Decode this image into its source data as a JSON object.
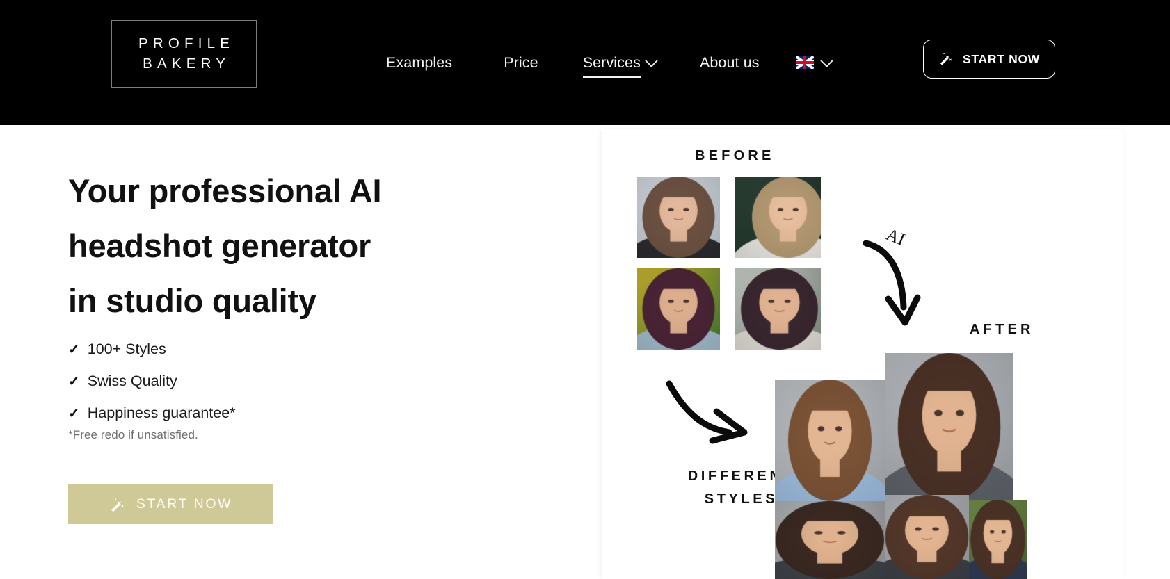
{
  "header": {
    "logo": {
      "line1": "PROFILE",
      "line2": "BAKERY",
      "name": "profile-bakery-logo"
    },
    "nav": [
      {
        "label": "Examples",
        "has_chevron": false,
        "underlined": false
      },
      {
        "label": "Price",
        "has_chevron": false,
        "underlined": false
      },
      {
        "label": "Services",
        "has_chevron": true,
        "underlined": true
      },
      {
        "label": "About us",
        "has_chevron": false,
        "underlined": false
      }
    ],
    "language": {
      "flag": "uk-flag-icon",
      "chevron": "chevron-down-icon"
    },
    "cta": {
      "label": "START NOW",
      "icon": "magic-wand-icon",
      "border_color": "#ffffff"
    }
  },
  "hero": {
    "headline_lines": [
      "Your professional AI",
      "headshot generator",
      "in studio quality"
    ],
    "benefits": [
      {
        "tick": "✓",
        "label": "100+ Styles"
      },
      {
        "tick": "✓",
        "label": "Swiss Quality"
      },
      {
        "tick": "✓",
        "label": "Happiness guarantee*"
      }
    ],
    "fineprint": "*Free redo if unsatisfied.",
    "cta": {
      "label": "START NOW",
      "icon": "magic-wand-icon",
      "background": "#cfc897",
      "text_color": "#ffffff"
    }
  },
  "showcase": {
    "label_before": "BEFORE",
    "label_after": "AFTER",
    "label_styles_line1": "DIFFERENT",
    "label_styles_line2": "STYLES",
    "ai_annotation": "AI",
    "arrows": [
      {
        "name": "ai-curved-arrow-icon",
        "direction": "down"
      },
      {
        "name": "styles-curved-arrow-icon",
        "direction": "down-right"
      }
    ],
    "before_photos": [
      {
        "name": "before-photo-1",
        "alt": "woman with long brown hair, grey studio background"
      },
      {
        "name": "before-photo-2",
        "alt": "woman with blonde hair, dark green background"
      },
      {
        "name": "before-photo-3",
        "alt": "woman with dark hair outdoors, yellow and green background"
      },
      {
        "name": "before-photo-4",
        "alt": "woman with dark wavy hair, indoor selfie"
      }
    ],
    "after_photos": [
      {
        "name": "after-photo-1",
        "alt": "woman in light blue blazer, arms crossed, grey background"
      },
      {
        "name": "after-photo-2",
        "alt": "woman in grey suit, white top, grey background"
      },
      {
        "name": "after-photo-3",
        "alt": "closeup headshot, dark hair, grey background"
      },
      {
        "name": "after-photo-4",
        "alt": "closeup headshot, brown hair, grey background"
      },
      {
        "name": "after-photo-5",
        "alt": "woman outdoors, blurred green background"
      }
    ]
  },
  "colors": {
    "header_bg": "#000000",
    "page_bg": "#ffffff",
    "accent": "#cfc897",
    "text_dark": "#111111",
    "text_muted": "#6f6f6f"
  }
}
